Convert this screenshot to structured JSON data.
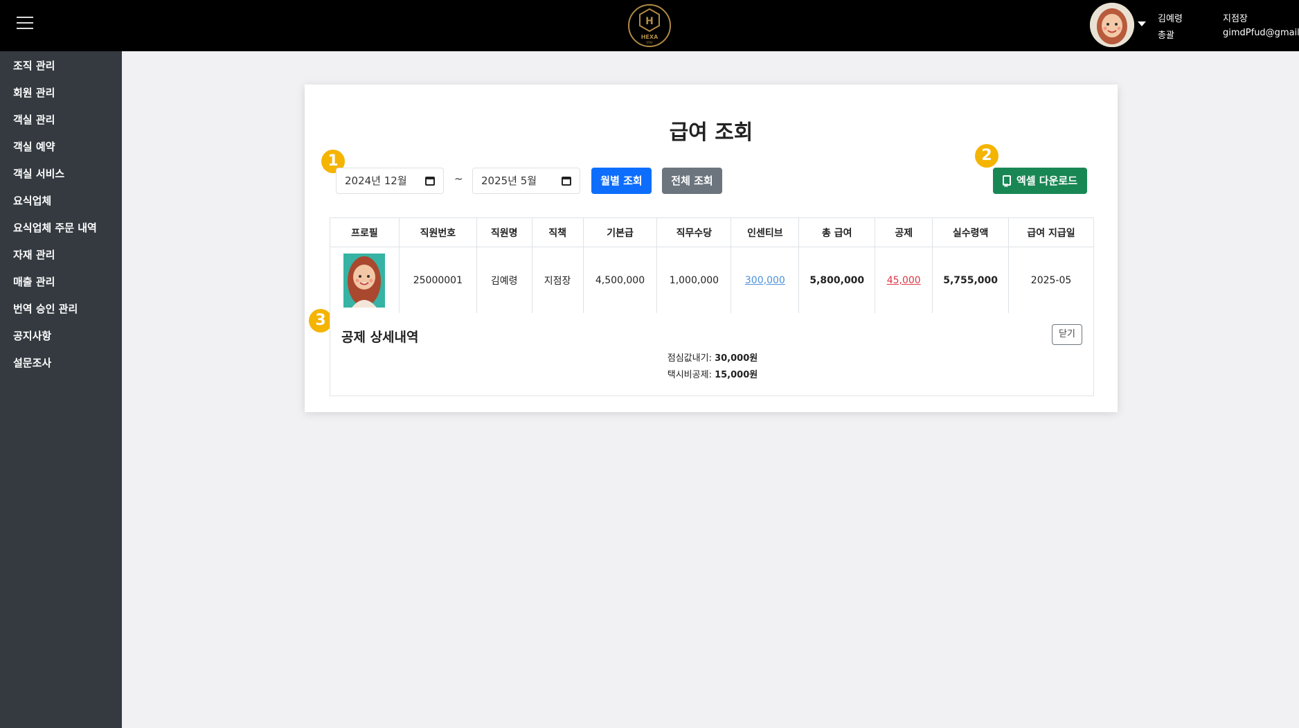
{
  "header": {
    "user_name": "김예령",
    "user_dept": "총괄",
    "user_role": "지점장",
    "user_email": "gimdPfud@gmail"
  },
  "sidebar": {
    "items": [
      {
        "label": "조직 관리"
      },
      {
        "label": "회원 관리"
      },
      {
        "label": "객실 관리"
      },
      {
        "label": "객실 예약"
      },
      {
        "label": "객실 서비스"
      },
      {
        "label": "요식업체"
      },
      {
        "label": "요식업체 주문 내역"
      },
      {
        "label": "자재 관리"
      },
      {
        "label": "매출 관리"
      },
      {
        "label": "번역 승인 관리"
      },
      {
        "label": "공지사항"
      },
      {
        "label": "설문조사"
      }
    ]
  },
  "main": {
    "title": "급여 조회",
    "markers": [
      "1",
      "2",
      "3"
    ],
    "start_month": "2024년 12월",
    "separator": "~",
    "end_month": "2025년 5월",
    "monthly_button": "월별 조회",
    "all_button": "전체 조회",
    "excel_button": "엑셀 다운로드",
    "table": {
      "headers": [
        "프로필",
        "직원번호",
        "직원명",
        "직책",
        "기본급",
        "직무수당",
        "인센티브",
        "총 급여",
        "공제",
        "실수령액",
        "급여 지급일"
      ],
      "rows": [
        {
          "employee_no": "25000001",
          "name": "김예령",
          "position": "지점장",
          "base_pay": "4,500,000",
          "allowance": "1,000,000",
          "incentive": "300,000",
          "total": "5,800,000",
          "deduction": "45,000",
          "net": "5,755,000",
          "pay_date": "2025-05"
        }
      ]
    },
    "deduction_detail": {
      "title": "공제 상세내역",
      "close_button": "닫기",
      "items": [
        {
          "label": "점심값내기:",
          "amount": "30,000원"
        },
        {
          "label": "택시비공제:",
          "amount": "15,000원"
        }
      ]
    }
  },
  "colors": {
    "topbar": "#000000",
    "sidebar": "#343a40",
    "primary": "#0d6efd",
    "secondary": "#6c757d",
    "success": "#198754",
    "marker": "#f4b400",
    "incentive_link": "#4a90d9",
    "deduction_link": "#dc3545"
  }
}
